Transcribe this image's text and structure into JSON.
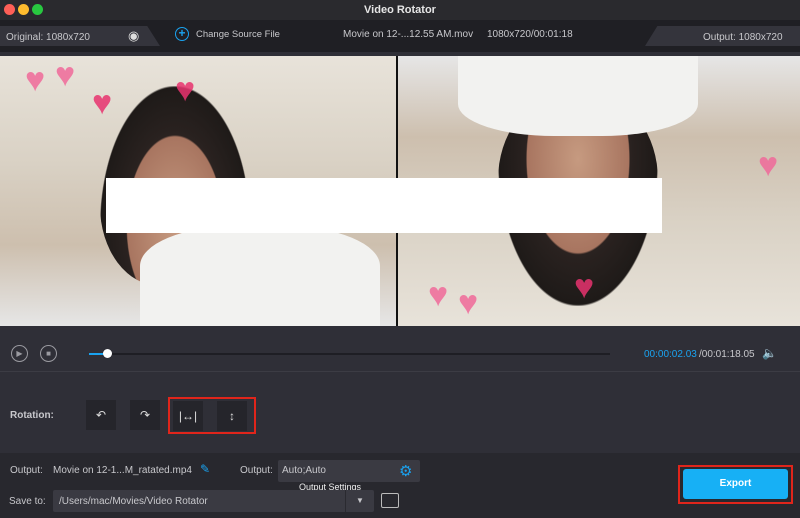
{
  "window": {
    "title": "Video Rotator"
  },
  "infobar": {
    "original": "Original: 1080x720",
    "change_source": "Change Source File",
    "file_name": "Movie on 12-...12.55 AM.mov",
    "file_info": "1080x720/00:01:18",
    "output": "Output: 1080x720"
  },
  "player": {
    "current_time": "00:00:02.03",
    "total_time": "/00:01:18.05",
    "progress_percent": 3
  },
  "rotation": {
    "label": "Rotation:",
    "buttons": [
      "rotate-left",
      "rotate-right",
      "flip-horizontal",
      "flip-vertical"
    ]
  },
  "output": {
    "label": "Output:",
    "file_name": "Movie on 12-1...M_ratated.mp4",
    "settings_label": "Output:",
    "settings_value": "Auto;Auto",
    "tooltip": "Output Settings"
  },
  "save": {
    "label": "Save to:",
    "path": "/Users/mac/Movies/Video Rotator"
  },
  "export": {
    "label": "Export"
  },
  "colors": {
    "accent": "#1aa3f0",
    "highlight": "#e0251b",
    "export": "#17b0f5"
  }
}
